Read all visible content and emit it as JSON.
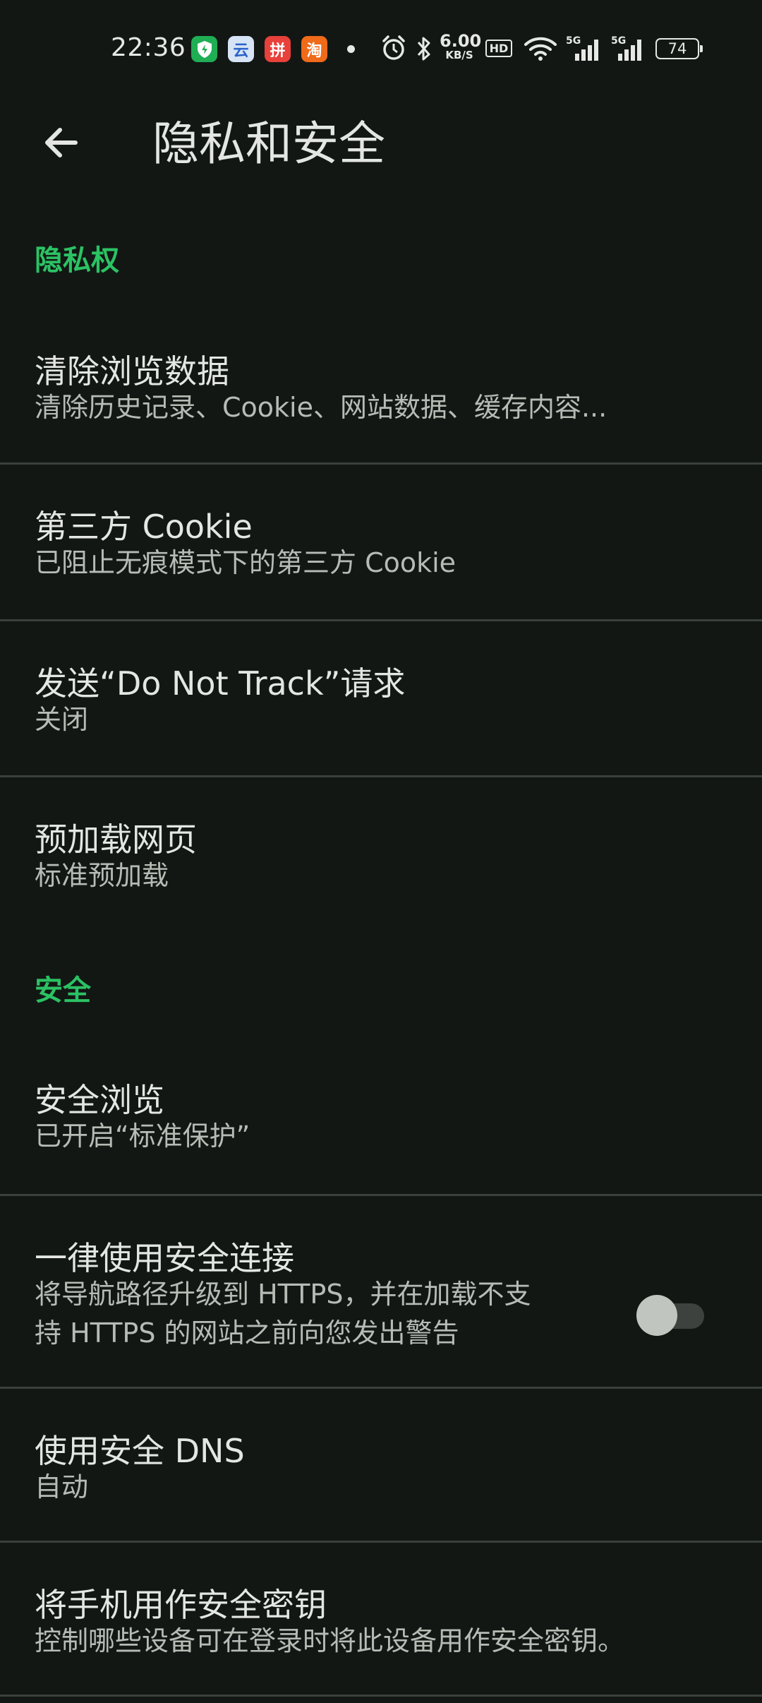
{
  "status_bar": {
    "time": "22:36",
    "app_icons": [
      "shield-app-icon",
      "cloud-app-icon",
      "pinduoduo-app-icon",
      "taobao-app-icon"
    ],
    "taobao_glyph": "淘",
    "cloud_glyph": "云",
    "pdd_glyph": "拼",
    "net_speed_value": "6.00",
    "net_speed_unit": "KB/S",
    "hd_label": "HD",
    "signal1_label": "5G",
    "signal2_label": "5G",
    "battery": "74"
  },
  "app_bar": {
    "title": "隐私和安全"
  },
  "sections": {
    "privacy_header": "隐私权",
    "security_header": "安全"
  },
  "items": {
    "clear_browsing_data": {
      "title": "清除浏览数据",
      "summary": "清除历史记录、Cookie、网站数据、缓存内容..."
    },
    "third_party_cookie": {
      "title": "第三方 Cookie",
      "summary": "已阻止无痕模式下的第三方 Cookie"
    },
    "do_not_track": {
      "title": "发送“Do Not Track”请求",
      "summary": "关闭"
    },
    "preload_pages": {
      "title": "预加载网页",
      "summary": "标准预加载"
    },
    "safe_browsing": {
      "title": "安全浏览",
      "summary": "已开启“标准保护”"
    },
    "https_first": {
      "title": "一律使用安全连接",
      "summary_line1": "将导航路径升级到 HTTPS，并在加载不支",
      "summary_line2": "持 HTTPS 的网站之前向您发出警告",
      "enabled": false
    },
    "secure_dns": {
      "title": "使用安全 DNS",
      "summary": "自动"
    },
    "security_key": {
      "title": "将手机用作安全密钥",
      "summary": "控制哪些设备可在登录时将此设备用作安全密钥。"
    }
  },
  "colors": {
    "background": "#121714",
    "accent": "#2cc264",
    "divider": "#3a403b"
  }
}
